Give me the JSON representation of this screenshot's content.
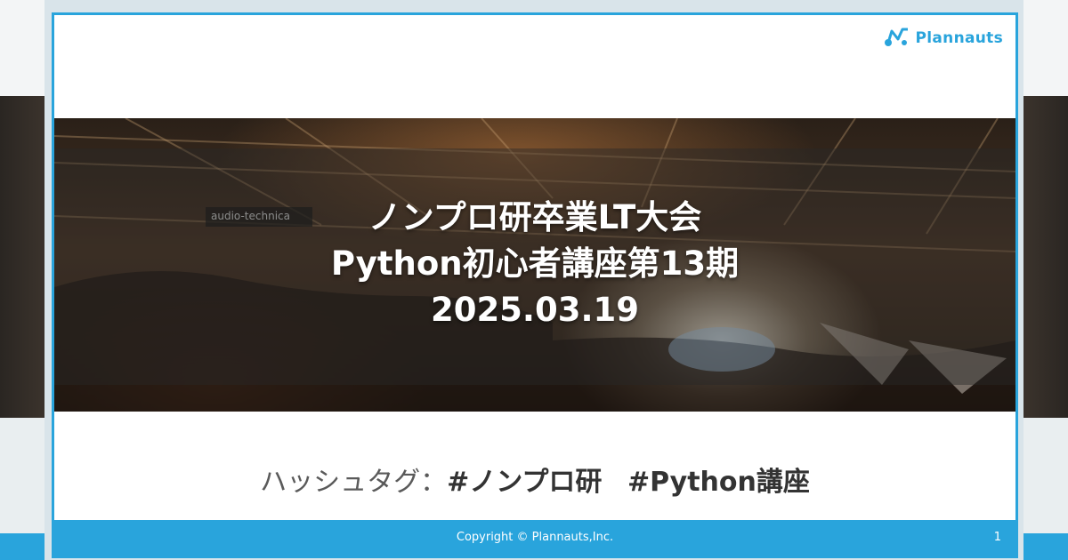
{
  "logo": {
    "text": "Plannauts",
    "icon": "plannauts-logo-icon",
    "color": "#29a4dc"
  },
  "hero": {
    "title_lines": [
      "ノンプロ研卒業LT大会",
      "Python初心者講座第13期",
      "2025.03.19"
    ],
    "background_sign": "audio-technica"
  },
  "hashtags": {
    "label": "ハッシュタグ：",
    "tags": [
      "#ノンプロ研",
      "#Python講座"
    ]
  },
  "footer": {
    "copyright": "Copyright © Plannauts,Inc.",
    "page_number": "1",
    "color": "#29a4dc"
  }
}
